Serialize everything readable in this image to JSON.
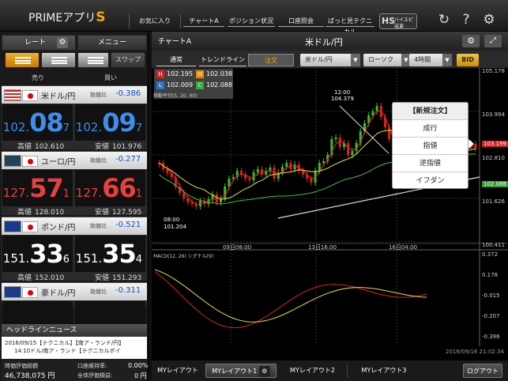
{
  "app": {
    "logo_text": "PRIMEアプリ",
    "logo_s": "S"
  },
  "nav": {
    "favorites": "お気に入り",
    "chart_a": "チャートA",
    "position": "ポジション状況",
    "account": "口座照会",
    "technical": "ぱっと見テクニカル",
    "hs_label": "HS",
    "hs_line1": "ハイスピード",
    "hs_line2": "注文"
  },
  "left": {
    "tab_rate": "レート",
    "tab_menu": "メニュー",
    "swap": "スワップ",
    "sell": "売り",
    "buy": "買い",
    "high_label": "高値",
    "low_label": "安値",
    "change_label": "始値比"
  },
  "pairs": [
    {
      "name": "米ドル/円",
      "change": "-0.386",
      "bid_small": "102.",
      "bid_large": "08",
      "bid_pip": "7",
      "ask_small": "102.",
      "ask_large": "09",
      "ask_pip": "7",
      "high": "102.610",
      "low": "101.976",
      "color": "blue"
    },
    {
      "name": "ユーロ/円",
      "change": "-0.277",
      "bid_small": "127.",
      "bid_large": "57",
      "bid_pip": "1",
      "ask_small": "127.",
      "ask_large": "66",
      "ask_pip": "1",
      "high": "128.010",
      "low": "127.595",
      "color": "red"
    },
    {
      "name": "ポンド/円",
      "change": "-0.521",
      "bid_small": "151.",
      "bid_large": "33",
      "bid_pip": "6",
      "ask_small": "151.",
      "ask_large": "35",
      "ask_pip": "4",
      "high": "152.010",
      "low": "151.293",
      "color": "white"
    },
    {
      "name": "豪ドル/円",
      "change": "-0.311",
      "bid_small": "",
      "bid_large": "",
      "bid_pip": "",
      "ask_small": "",
      "ask_large": "",
      "ask_pip": "",
      "high": "",
      "low": "",
      "color": "white"
    }
  ],
  "news": {
    "title": "ヘッドラインニュース",
    "line1": "2016/09/15【テクニカル】【南ア・ランド/円】",
    "line2": "14:10ドル/南ア・ランド【テクニカルポイ"
  },
  "account": {
    "equity_label": "時価評価総額",
    "equity": "46,738,075 円",
    "margin_label": "口座維持率:",
    "margin": "0.00%",
    "pl_label": "全体評価損益:",
    "pl": "0 円"
  },
  "chart": {
    "title": "チャートA",
    "pair": "米ドル/円",
    "tab_normal": "通常",
    "tab_trend": "トレンドライン",
    "tab_order": "注文",
    "sel_pair": "米ドル/円",
    "sel_type": "ローソク",
    "sel_period": "4時間",
    "bid": "BID",
    "ohlc": {
      "H": "102.195",
      "O": "102.038",
      "L": "102.009",
      "C": "102.088"
    },
    "ma_label": "移動平均(5, 20, 90)",
    "macd_label": "MACD(12, 26) シグナル(9)",
    "y_ticks": [
      "105.178",
      "103.994",
      "102.810",
      "101.626",
      "100.411"
    ],
    "macd_ticks": [
      "0.372",
      "0.178",
      "-0.015",
      "-0.207",
      "-0.396"
    ],
    "x_ticks": [
      "09日08:00",
      "13日16:00",
      "16日04:00"
    ],
    "price_tag_red": "103.199",
    "price_tag_green": "102.088",
    "ann_high_time": "12:00",
    "ann_high": "104.379",
    "ann_low_time": "08:00",
    "ann_low": "101.204",
    "timestamp": "2016/09/16 21:02:34"
  },
  "popup": {
    "title": "【新規注文】",
    "items": [
      "成行",
      "指値",
      "逆指値",
      "イフダン"
    ]
  },
  "bottom": {
    "my_layout": "MYレイアウト",
    "l1": "MYレイアウト1",
    "l2": "MYレイアウト2",
    "l3": "MYレイアウト3",
    "logout": "ログアウト"
  }
}
